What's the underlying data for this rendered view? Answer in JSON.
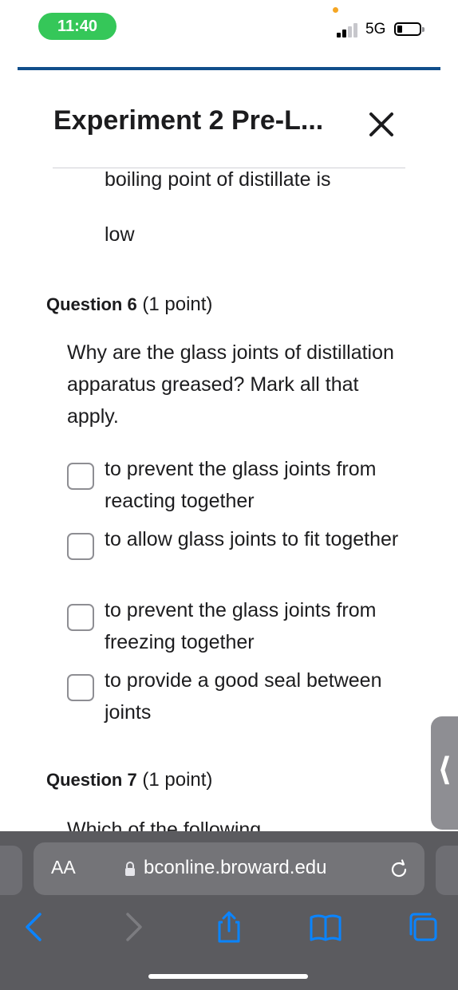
{
  "status_bar": {
    "time": "11:40",
    "network": "5G"
  },
  "header": {
    "title": "Experiment 2 Pre-L..."
  },
  "previous_option": {
    "clipped_text": "boiling point of distillate is",
    "tail": "low"
  },
  "question6": {
    "number_label": "Question 6",
    "points": "(1 point)",
    "text": "Why are the glass joints of distillation apparatus greased? Mark all that apply.",
    "options": [
      {
        "label": "to prevent the glass joints from reacting together",
        "checked": false
      },
      {
        "label": "to allow glass joints to fit together",
        "checked": false
      },
      {
        "label": "to prevent the glass joints from freezing together",
        "checked": false
      },
      {
        "label": "to provide a good seal between joints",
        "checked": false
      }
    ]
  },
  "question7": {
    "number_label": "Question 7",
    "points": "(1 point)",
    "text_start": "Which of the following"
  },
  "browser": {
    "text_size_label": "AA",
    "url": "bconline.broward.edu"
  },
  "colors": {
    "accent_blue": "#104e8b",
    "status_green": "#35c759",
    "toolbar_blue": "#0a84ff",
    "browser_bg": "#5b5b5f"
  }
}
